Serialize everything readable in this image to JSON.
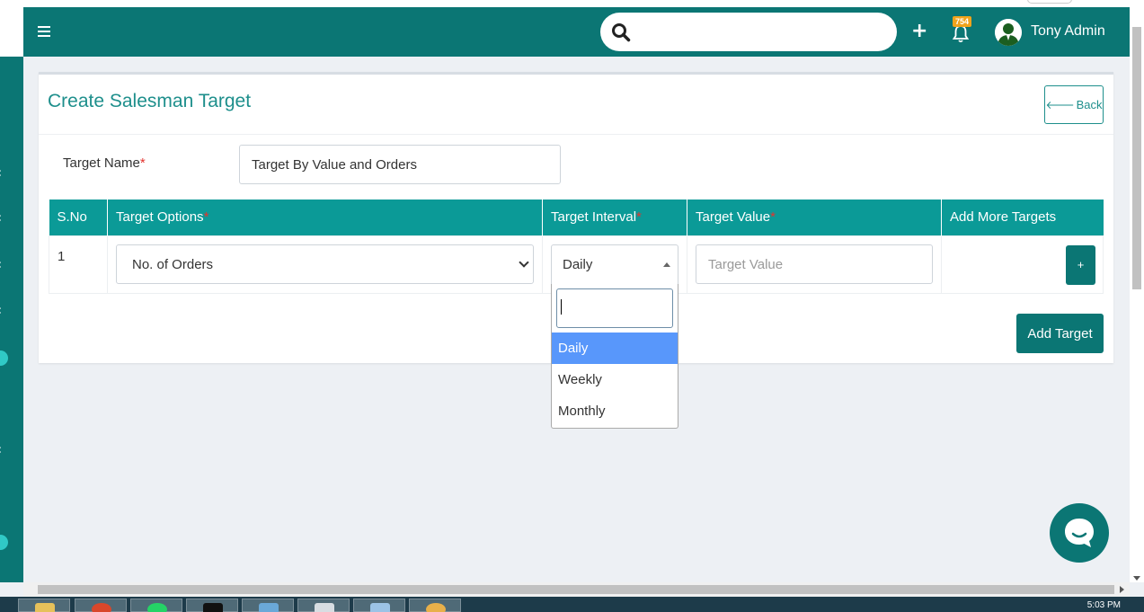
{
  "header": {
    "search_placeholder": "",
    "notification_count": "754",
    "user_name": "Tony Admin"
  },
  "page": {
    "title": "Create Salesman Target",
    "back_label": "Back"
  },
  "form": {
    "target_name_label": "Target Name",
    "required_mark": "*",
    "target_name_value": "Target By Value and Orders"
  },
  "table": {
    "headers": {
      "sno": "S.No",
      "target_options": "Target Options",
      "target_interval": "Target Interval",
      "target_value": "Target Value",
      "add_more": "Add More Targets"
    },
    "rows": [
      {
        "sno": "1",
        "target_option": "No. of Orders",
        "target_interval": "Daily",
        "target_value_placeholder": "Target Value",
        "add_more_label": "+"
      }
    ]
  },
  "dropdown": {
    "search_value": "",
    "options": [
      "Daily",
      "Weekly",
      "Monthly"
    ],
    "highlighted": "Daily"
  },
  "actions": {
    "add_target_label": "Add Target"
  },
  "taskbar": {
    "clock": "5:03 PM"
  },
  "colors": {
    "primary": "#0b7674",
    "table_header": "#0b9a97",
    "title": "#1e8f8c",
    "highlight": "#5897fb",
    "badge": "#f0a31b",
    "required": "#e3342f"
  },
  "icons": {
    "menu": "hamburger-icon",
    "search": "search-icon",
    "add": "plus-icon",
    "notifications": "bell-icon",
    "back": "arrow-left-icon",
    "chat": "chat-bubble-icon"
  }
}
